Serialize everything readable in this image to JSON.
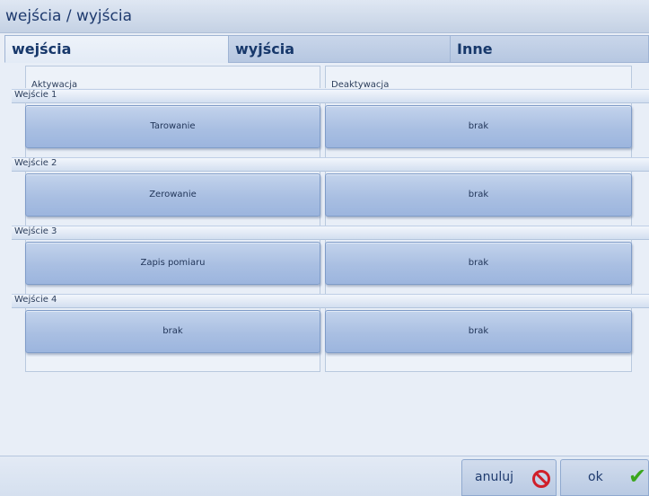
{
  "window": {
    "title": "wejścia / wyjścia"
  },
  "tabs": [
    {
      "label": "wejścia",
      "active": true
    },
    {
      "label": "wyjścia",
      "active": false
    },
    {
      "label": "Inne",
      "active": false
    }
  ],
  "columns": {
    "activation": "Aktywacja",
    "deactivation": "Deaktywacja"
  },
  "inputs": [
    {
      "label": "Wejście 1",
      "activation": "Tarowanie",
      "deactivation": "brak"
    },
    {
      "label": "Wejście 2",
      "activation": "Zerowanie",
      "deactivation": "brak"
    },
    {
      "label": "Wejście 3",
      "activation": "Zapis pomiaru",
      "deactivation": "brak"
    },
    {
      "label": "Wejście 4",
      "activation": "brak",
      "deactivation": "brak"
    }
  ],
  "footer": {
    "cancel_label": "anuluj",
    "ok_label": "ok"
  },
  "icons": {
    "cancel": "no-entry-icon",
    "ok": "checkmark-icon"
  },
  "colors": {
    "cancel_icon": "#d01f2a",
    "ok_icon": "#3aa61c",
    "title_text": "#1e3a6e"
  }
}
